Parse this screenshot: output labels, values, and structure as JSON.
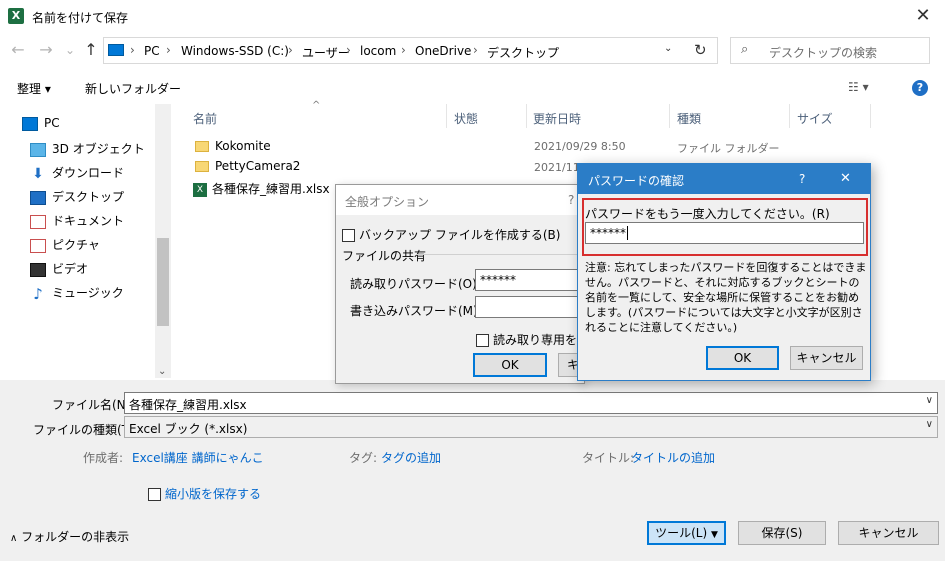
{
  "window": {
    "title": "名前を付けて保存",
    "icon": "X",
    "close": "✕"
  },
  "nav": {
    "back": "←",
    "forward": "→",
    "recent": "⌄",
    "up": "↑",
    "path": [
      "PC",
      "Windows-SSD (C:)",
      "ユーザー",
      "locom",
      "OneDrive",
      "デスクトップ"
    ],
    "sep": "›",
    "refresh": "↻",
    "search_placeholder": "デスクトップの検索"
  },
  "toolbar": {
    "organize": "整理 ▾",
    "new_folder": "新しいフォルダー",
    "help": "?"
  },
  "tree": [
    {
      "label": "PC",
      "icon": "pc-icon"
    },
    {
      "label": "3D オブジェクト",
      "icon": "cube-icon"
    },
    {
      "label": "ダウンロード",
      "icon": "download-icon"
    },
    {
      "label": "デスクトップ",
      "icon": "desktop-icon"
    },
    {
      "label": "ドキュメント",
      "icon": "document-icon"
    },
    {
      "label": "ピクチャ",
      "icon": "picture-icon"
    },
    {
      "label": "ビデオ",
      "icon": "video-icon"
    },
    {
      "label": "ミュージック",
      "icon": "music-icon"
    }
  ],
  "columns": {
    "name": "名前",
    "status": "状態",
    "date": "更新日時",
    "type": "種類",
    "size": "サイズ"
  },
  "files": [
    {
      "name": "Kokomite",
      "date": "2021/09/29 8:50",
      "type": "ファイル フォルダー",
      "icon": "folder-icon"
    },
    {
      "name": "PettyCamera2",
      "date": "2021/11/",
      "type": "",
      "icon": "folder-icon"
    },
    {
      "name": "各種保存_練習用.xlsx",
      "date": "",
      "type": "",
      "icon": "excel-file-icon"
    }
  ],
  "bottom": {
    "filename_label": "ファイル名(N):",
    "filename_value": "各種保存_練習用.xlsx",
    "filetype_label": "ファイルの種類(T):",
    "filetype_value": "Excel ブック (*.xlsx)",
    "author_label": "作成者:",
    "author_value": "Excel講座 講師にゃんこ",
    "tags_label": "タグ:",
    "tags_value": "タグの追加",
    "title_label": "タイトル:",
    "title_value": "タイトルの追加",
    "thumbnail": "縮小版を保存する",
    "hide_folders": "フォルダーの非表示",
    "tools": "ツール(L)",
    "save": "保存(S)",
    "cancel": "キャンセル"
  },
  "options_dialog": {
    "title": "全般オプション",
    "help": "?",
    "backup": "バックアップ ファイルを作成する(B)",
    "sharing": "ファイルの共有",
    "read_pw_label": "読み取りパスワード(O):",
    "read_pw_value": "******",
    "write_pw_label": "書き込みパスワード(M):",
    "readonly": "読み取り専用を推",
    "ok": "OK",
    "cancel_partial": "キ"
  },
  "password_dialog": {
    "title": "パスワードの確認",
    "help": "?",
    "close": "✕",
    "prompt": "パスワードをもう一度入力してください。(R)",
    "value": "******",
    "note": "注意: 忘れてしまったパスワードを回復することはできません。パスワードと、それに対応するブックとシートの名前を一覧にして、安全な場所に保管することをお勧めします。(パスワードについては大文字と小文字が区別されることに注意してください。)",
    "ok": "OK",
    "cancel": "キャンセル"
  },
  "colors": {
    "accent": "#2b7dc7",
    "highlight": "#d72f2f",
    "excel": "#1d6f42",
    "link": "#0066cc"
  }
}
